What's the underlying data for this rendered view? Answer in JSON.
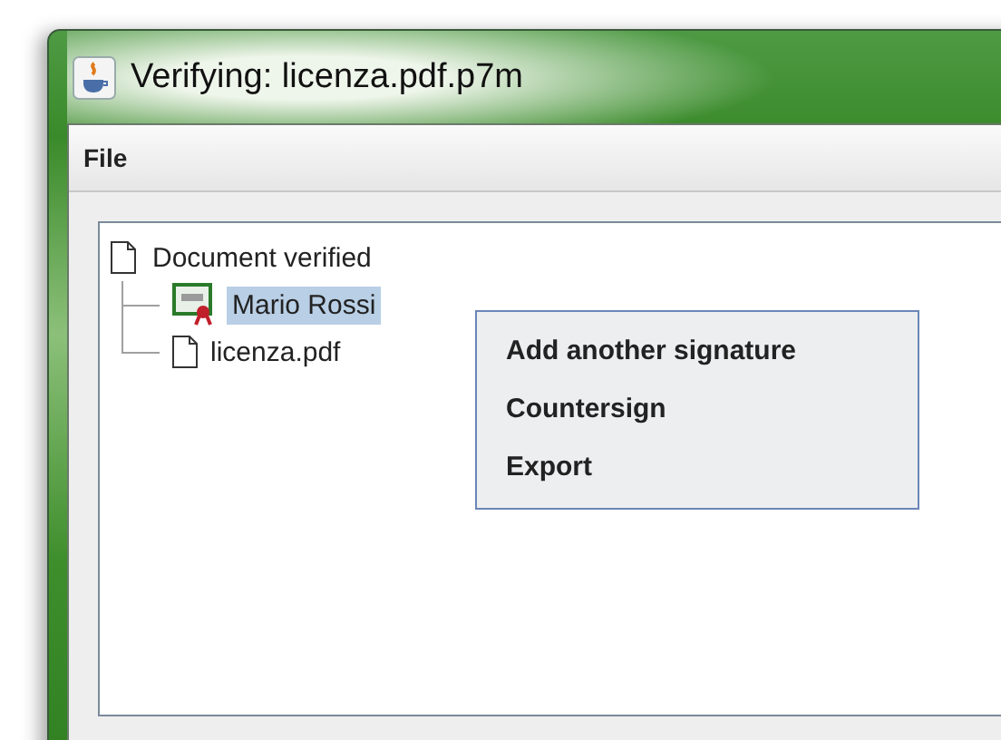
{
  "window": {
    "title": "Verifying: licenza.pdf.p7m"
  },
  "menu_bar": [
    {
      "label": "File"
    }
  ],
  "tree": [
    {
      "label": "Document verified",
      "kind": "document",
      "selected": false,
      "children": [
        {
          "label": "Mario Rossi",
          "kind": "signature",
          "selected": true
        },
        {
          "label": "licenza.pdf",
          "kind": "document",
          "selected": false
        }
      ]
    }
  ],
  "context_menu": [
    {
      "label": "Add another signature"
    },
    {
      "label": "Countersign"
    },
    {
      "label": "Export"
    }
  ]
}
